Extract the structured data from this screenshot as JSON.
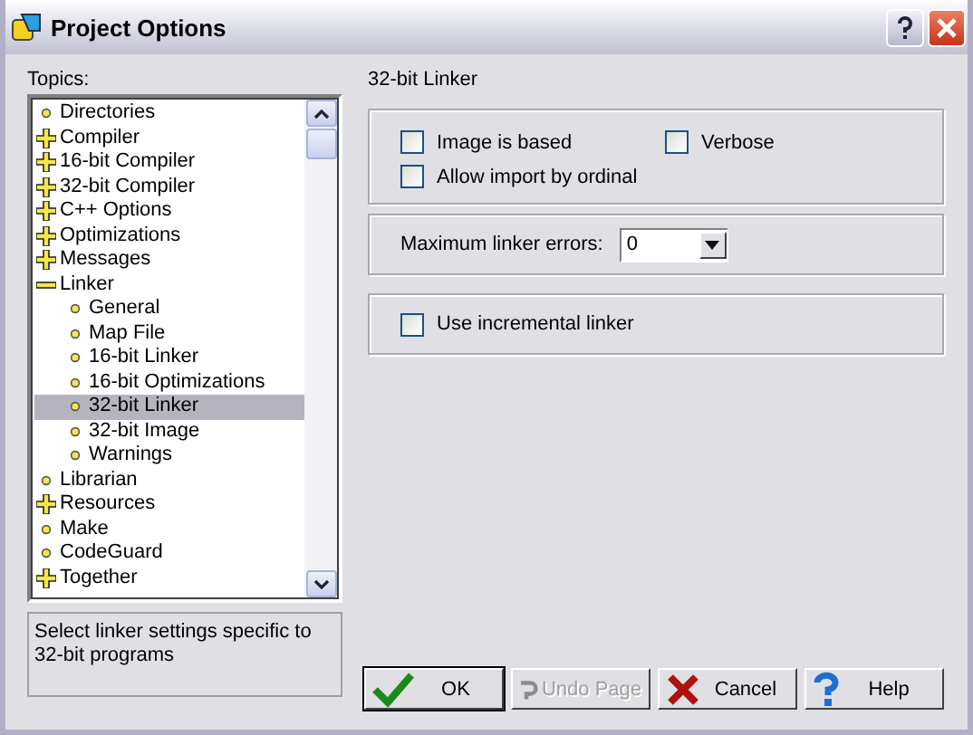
{
  "window": {
    "title": "Project Options"
  },
  "topics": {
    "label": "Topics:",
    "items": [
      {
        "label": "Directories",
        "kind": "leaf",
        "selected": false
      },
      {
        "label": "Compiler",
        "kind": "node",
        "expanded": false,
        "selected": false
      },
      {
        "label": "16-bit Compiler",
        "kind": "node",
        "expanded": false,
        "selected": false
      },
      {
        "label": "32-bit Compiler",
        "kind": "node",
        "expanded": false,
        "selected": false
      },
      {
        "label": "C++ Options",
        "kind": "node",
        "expanded": false,
        "selected": false
      },
      {
        "label": "Optimizations",
        "kind": "node",
        "expanded": false,
        "selected": false
      },
      {
        "label": "Messages",
        "kind": "node",
        "expanded": false,
        "selected": false
      },
      {
        "label": "Linker",
        "kind": "node",
        "expanded": true,
        "selected": false,
        "children": [
          {
            "label": "General",
            "kind": "leaf",
            "selected": false
          },
          {
            "label": "Map File",
            "kind": "leaf",
            "selected": false
          },
          {
            "label": "16-bit Linker",
            "kind": "leaf",
            "selected": false
          },
          {
            "label": "16-bit Optimizations",
            "kind": "leaf",
            "selected": false
          },
          {
            "label": "32-bit Linker",
            "kind": "leaf",
            "selected": true
          },
          {
            "label": "32-bit Image",
            "kind": "leaf",
            "selected": false
          },
          {
            "label": "Warnings",
            "kind": "leaf",
            "selected": false
          }
        ]
      },
      {
        "label": "Librarian",
        "kind": "leaf",
        "selected": false
      },
      {
        "label": "Resources",
        "kind": "node",
        "expanded": false,
        "selected": false
      },
      {
        "label": "Make",
        "kind": "leaf",
        "selected": false
      },
      {
        "label": "CodeGuard",
        "kind": "leaf",
        "selected": false
      },
      {
        "label": "Together",
        "kind": "node",
        "expanded": false,
        "selected": false
      }
    ]
  },
  "description": "Select linker settings specific to 32-bit programs",
  "page_title": "32-bit Linker",
  "group_1": {
    "checkboxes": [
      {
        "label": "Image is based",
        "checked": false
      },
      {
        "label": "Verbose",
        "checked": false
      },
      {
        "label": "Allow import by ordinal",
        "checked": false
      }
    ]
  },
  "group_2": {
    "label": "Maximum linker errors:",
    "value": "0"
  },
  "group_3": {
    "checkboxes": [
      {
        "label": "Use incremental linker",
        "checked": false
      }
    ]
  },
  "buttons": [
    {
      "label": "OK",
      "kind": "ok",
      "disabled": false,
      "default": true
    },
    {
      "label": "Undo Page",
      "kind": "undo",
      "disabled": true,
      "default": false
    },
    {
      "label": "Cancel",
      "kind": "cancel",
      "disabled": false,
      "default": false
    },
    {
      "label": "Help",
      "kind": "help",
      "disabled": false,
      "default": false
    }
  ]
}
